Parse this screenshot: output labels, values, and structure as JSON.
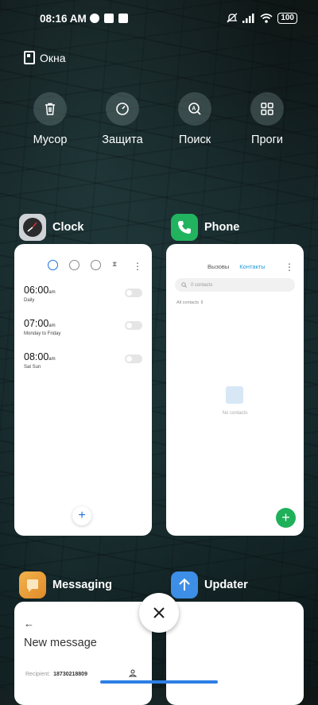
{
  "status_bar": {
    "time": "08:16 AM",
    "battery": "100"
  },
  "windows_label": "Окна",
  "quick_actions": [
    {
      "label": "Мусор",
      "icon": "trash-icon"
    },
    {
      "label": "Защита",
      "icon": "shield-gauge-icon"
    },
    {
      "label": "Поиск",
      "icon": "search-app-icon"
    },
    {
      "label": "Проги",
      "icon": "apps-grid-icon"
    }
  ],
  "apps": {
    "clock": {
      "name": "Clock",
      "alarms": [
        {
          "time": "06:00",
          "ampm": "am",
          "days": "Daily"
        },
        {
          "time": "07:00",
          "ampm": "am",
          "days": "Monday to Friday"
        },
        {
          "time": "08:00",
          "ampm": "am",
          "days": "Sat Sun"
        }
      ]
    },
    "phone": {
      "name": "Phone",
      "tabs": [
        "Вызовы",
        "Контакты"
      ],
      "active_tab": "Контакты",
      "search_placeholder": "0 contacts",
      "filter": "All contacts",
      "empty_text": "No contacts"
    },
    "messaging": {
      "name": "Messaging",
      "title": "New message",
      "recipient_label": "Recipient:",
      "recipient_value": "18730218809"
    },
    "updater": {
      "name": "Updater"
    }
  },
  "colors": {
    "accent_blue": "#1d6fe0",
    "phone_green": "#1fb15a",
    "home_bar": "#2d7fe5"
  }
}
